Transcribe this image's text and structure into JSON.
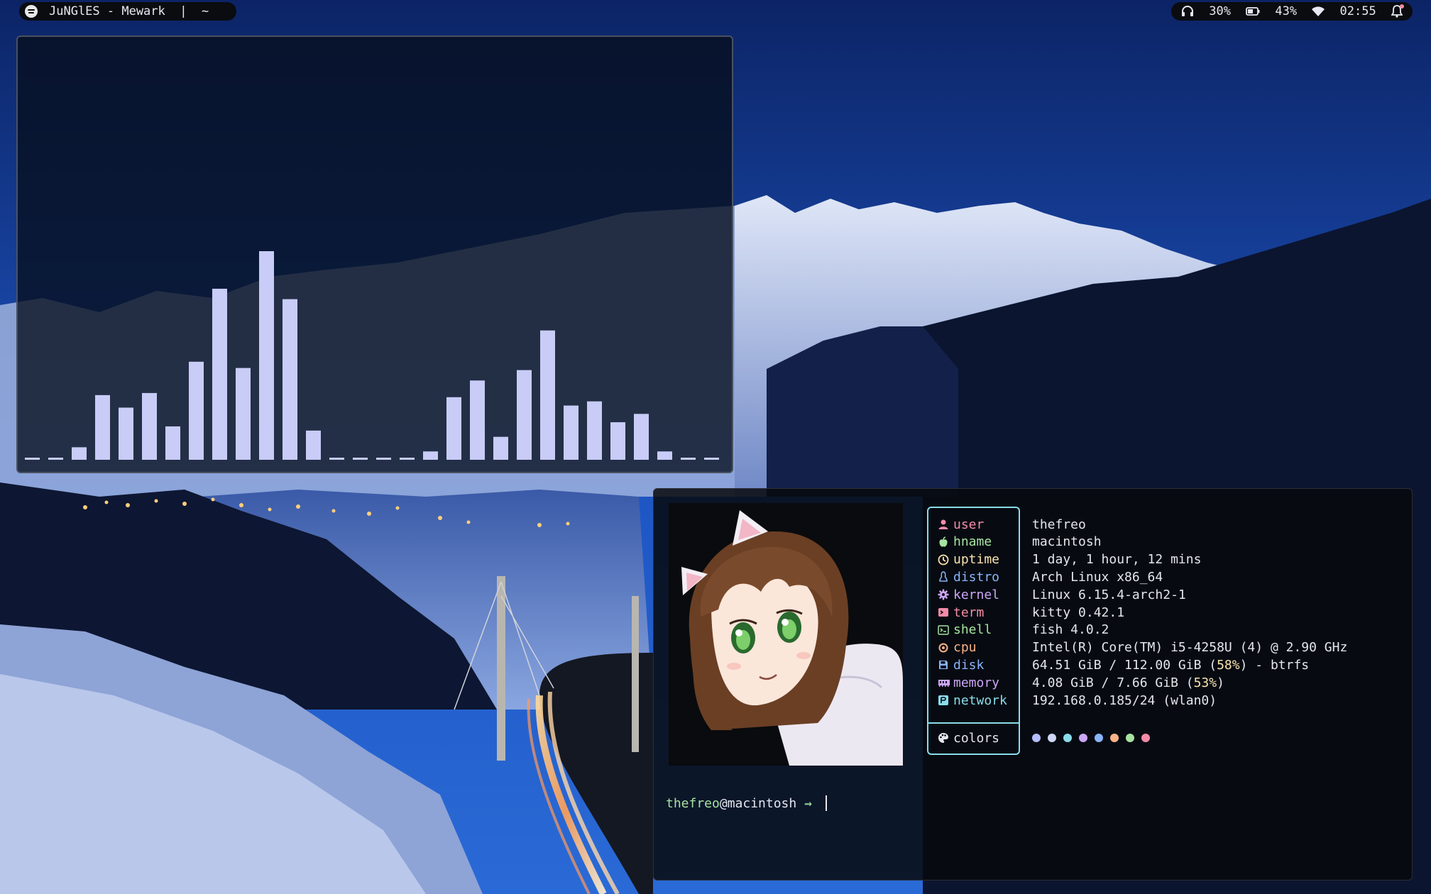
{
  "topbar": {
    "left": {
      "icon": "spotify-icon",
      "text": "JuNGlES - Mewark  |  ~"
    },
    "right": {
      "headphone_icon": "headphones-icon",
      "volume": "30%",
      "battery_icon": "battery-icon",
      "battery": "43%",
      "wifi_icon": "wifi-icon",
      "time": "02:55",
      "bell_icon": "notification-bell-icon"
    }
  },
  "visualizer": {
    "bar_color": "#c8ccf6",
    "levels": [
      0.01,
      0.01,
      0.06,
      0.31,
      0.25,
      0.32,
      0.16,
      0.47,
      0.82,
      0.44,
      1.0,
      0.77,
      0.14,
      0.01,
      0.01,
      0.01,
      0.01,
      0.04,
      0.3,
      0.38,
      0.11,
      0.43,
      0.62,
      0.26,
      0.28,
      0.18,
      0.22,
      0.04,
      0.01,
      0.01
    ]
  },
  "terminal": {
    "fetch": [
      {
        "key": "user",
        "icon": "user-icon",
        "color": "#f38ba8",
        "value": "thefreo"
      },
      {
        "key": "hname",
        "icon": "apple-icon",
        "color": "#a6e3a1",
        "value": "macintosh"
      },
      {
        "key": "uptime",
        "icon": "clock-icon",
        "color": "#f9e2af",
        "value": "1 day, 1 hour, 12 mins"
      },
      {
        "key": "distro",
        "icon": "linux-icon",
        "color": "#89b4fa",
        "value": "Arch Linux x86_64"
      },
      {
        "key": "kernel",
        "icon": "gear-icon",
        "color": "#cba6f7",
        "value": "Linux 6.15.4-arch2-1"
      },
      {
        "key": "term",
        "icon": "terminal-icon",
        "color": "#f38ba8",
        "value": "kitty 0.42.1"
      },
      {
        "key": "shell",
        "icon": "shell-icon",
        "color": "#a6e3a1",
        "value": "fish 4.0.2"
      },
      {
        "key": "cpu",
        "icon": "cpu-icon",
        "color": "#fab387",
        "value": "Intel(R) Core(TM) i5-4258U (4) @ 2.90 GHz"
      },
      {
        "key": "disk",
        "icon": "disk-icon",
        "color": "#89b4fa",
        "value_pre": "64.51 GiB / 112.00 GiB (",
        "value_hl": "58%",
        "value_post": ") - btrfs"
      },
      {
        "key": "memory",
        "icon": "memory-icon",
        "color": "#cba6f7",
        "value_pre": "4.08 GiB / 7.66 GiB (",
        "value_hl": "53%",
        "value_post": ")"
      },
      {
        "key": "network",
        "icon": "network-icon",
        "color": "#89dceb",
        "value": "192.168.0.185/24 (wlan0)"
      }
    ],
    "colors_label": "colors",
    "colors_icon": "palette-icon",
    "palette": [
      "#b4befe",
      "#cdd6f4",
      "#89dceb",
      "#cba6f7",
      "#89b4fa",
      "#fab387",
      "#a6e3a1",
      "#f38ba8"
    ],
    "prompt": {
      "user": "thefreo",
      "at": "@",
      "host": "macintosh",
      "arrow": " ⇝ "
    }
  }
}
